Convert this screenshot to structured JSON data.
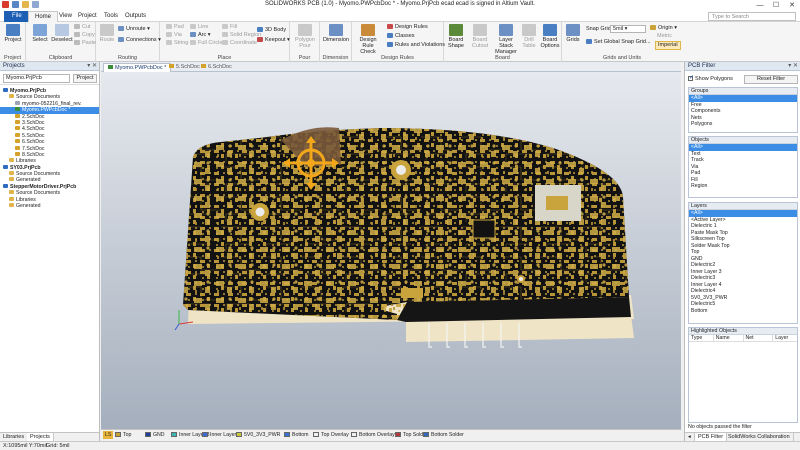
{
  "window": {
    "title": "SOLIDWORKS PCB (1.0) - Myomo.PWPcbDoc * - Myomo.PrjPcb ecad ecad is signed in Altium Vault.",
    "controls": [
      "—",
      "☐",
      "✕"
    ]
  },
  "ribbon_tabs": [
    "File",
    "Home",
    "View",
    "Project",
    "Tools",
    "Outputs"
  ],
  "active_tab": "Home",
  "search": {
    "placeholder": "Type to Search"
  },
  "ribbon": {
    "project": {
      "label": "Project",
      "group": "Project"
    },
    "select": {
      "label": "Select"
    },
    "deselect": {
      "label": "Deselect"
    },
    "clipboard": {
      "cut": "Cut",
      "copy": "Copy",
      "paste": "Paste",
      "group": "Clipboard"
    },
    "routing": {
      "route": "Route",
      "unroute": "Unroute",
      "connections": "Connections",
      "group": "Routing"
    },
    "place": {
      "pad": "Pad",
      "via": "Via",
      "string": "String",
      "line": "Line",
      "arc": "Arc",
      "full_circle": "Full Circle",
      "fill": "Fill",
      "solid_region": "Solid Region",
      "coordinate": "Coordinate",
      "body_3d": "3D Body",
      "keepout": "Keepout",
      "group": "Place"
    },
    "pour": {
      "polygon_pour": "Polygon Pour",
      "group": "Pour"
    },
    "dimension": {
      "label": "Dimension",
      "group": "Dimension"
    },
    "design_rules": {
      "rule_check": "Design Rule Check",
      "rules": "Design Rules",
      "classes": "Classes",
      "rules_violations": "Rules and Violations",
      "group": "Design Rules"
    },
    "board": {
      "board_shape": "Board Shape",
      "board_cutout": "Board Cutout",
      "layer_stack": "Layer Stack Manager",
      "drill_table": "Drill Table",
      "board_options": "Board Options",
      "group": "Board"
    },
    "grids": {
      "grids": "Grids",
      "snap_grid_label": "Snap Grid",
      "snap_grid_value": "5mil",
      "global_snap": "Set Global Snap Grid...",
      "origin": "Origin",
      "metric": "Metric",
      "imperial": "Imperial",
      "group": "Grids and Units"
    }
  },
  "projects_panel": {
    "title": "Projects",
    "project_field": "Myomo.PrjPcb",
    "project_button": "Project",
    "tree": [
      {
        "label": "Myomo.PrjPcb",
        "level": 0,
        "kind": "project",
        "selected": true
      },
      {
        "label": "Source Documents",
        "level": 1,
        "kind": "folder"
      },
      {
        "label": "myomo-052216_final_rev.",
        "level": 2,
        "kind": "doc"
      },
      {
        "label": "Myomo.PWPcbDoc *",
        "level": 2,
        "kind": "pcb",
        "selected": true
      },
      {
        "label": "2.SchDoc",
        "level": 2,
        "kind": "sch"
      },
      {
        "label": "3.SchDoc",
        "level": 2,
        "kind": "sch"
      },
      {
        "label": "4.SchDoc",
        "level": 2,
        "kind": "sch"
      },
      {
        "label": "5.SchDoc",
        "level": 2,
        "kind": "sch"
      },
      {
        "label": "6.SchDoc",
        "level": 2,
        "kind": "sch"
      },
      {
        "label": "7.SchDoc",
        "level": 2,
        "kind": "sch"
      },
      {
        "label": "8.SchDoc",
        "level": 2,
        "kind": "sch"
      },
      {
        "label": "Libraries",
        "level": 1,
        "kind": "folder"
      },
      {
        "label": "SY03.PrjPcb",
        "level": 0,
        "kind": "project"
      },
      {
        "label": "Source Documents",
        "level": 1,
        "kind": "folder"
      },
      {
        "label": "Generated",
        "level": 1,
        "kind": "folder"
      },
      {
        "label": "StepperMotorDriver.PrjPcb",
        "level": 0,
        "kind": "project"
      },
      {
        "label": "Source Documents",
        "level": 1,
        "kind": "folder"
      },
      {
        "label": "Libraries",
        "level": 1,
        "kind": "folder"
      },
      {
        "label": "Generated",
        "level": 1,
        "kind": "folder"
      }
    ],
    "bottom_tabs": [
      "Libraries",
      "Projects"
    ]
  },
  "document_tabs": [
    "Myomo.PWPcbDoc *",
    "5.SchDoc",
    "6.SchDoc"
  ],
  "layer_bar": {
    "ls": "LS",
    "layers": [
      {
        "name": "Top",
        "color": "#c8a233"
      },
      {
        "name": "GND",
        "color": "#1e3f9c"
      },
      {
        "name": "Inner Layer 3",
        "color": "#3db3b3"
      },
      {
        "name": "Inner Layer 4",
        "color": "#3d6bd6"
      },
      {
        "name": "5V0_3V3_PWR",
        "color": "#c8c83a"
      },
      {
        "name": "Bottom",
        "color": "#3a72d0"
      },
      {
        "name": "Top Overlay",
        "color": "#f0f0f0"
      },
      {
        "name": "Bottom Overlay",
        "color": "#f0f0f0"
      },
      {
        "name": "Top Solder",
        "color": "#b03a3a"
      },
      {
        "name": "Bottom Solder",
        "color": "#2e6abf"
      }
    ]
  },
  "filter_panel": {
    "title": "PCB Filter",
    "show_polygons": "Show Polygons",
    "reset_filter": "Reset Filter",
    "groups": [
      "Groups",
      "<All>",
      "Free",
      "Components",
      "Nets",
      "Polygons"
    ],
    "objects": [
      "Objects",
      "<All>",
      "Text",
      "Track",
      "Via",
      "Pad",
      "Fill",
      "Region"
    ],
    "layers": [
      "Layers",
      "<All>",
      "<Active Layer>",
      "Dielectric 1",
      "Paste Mask Top",
      "Silkscreen Top",
      "Solder Mask Top",
      "Top",
      "GND",
      "Dielectric2",
      "Inner Layer 3",
      "Dielectric3",
      "Inner Layer 4",
      "Dielectric4",
      "5V0_3V3_PWR",
      "Dielectric5",
      "Bottom"
    ],
    "highlighted": {
      "title": "Highlighted Objects",
      "columns": [
        "Type",
        "Name",
        "Net",
        "Layer"
      ]
    },
    "no_objects": "No objects passed the filter",
    "bottom_tabs": [
      "PCB Filter",
      "SolidWorks Collaboration"
    ]
  },
  "status": {
    "coords": "X:1095mil Y:70mil",
    "grid": "Grid: 5mil"
  }
}
